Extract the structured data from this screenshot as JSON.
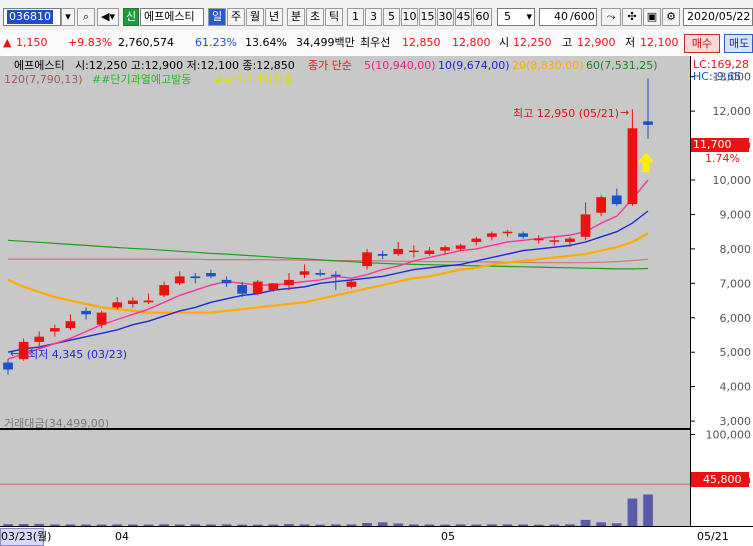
{
  "toolbar": {
    "code": "036810",
    "badge": "신",
    "name": "에프에스티",
    "periods": [
      "일",
      "주",
      "월",
      "년",
      "분",
      "초",
      "틱"
    ],
    "active_period": "일",
    "minutes": [
      "1",
      "3",
      "5",
      "10",
      "15",
      "30",
      "45",
      "60"
    ],
    "n_value": "5",
    "count": "40",
    "count_total": "/600",
    "date": "2020/05/22"
  },
  "quote": {
    "change": "1,150",
    "change_pct": "+9.83%",
    "volume": "2,760,574",
    "ratio1": "61.23%",
    "ratio2": "13.64%",
    "amount": "34,499백만",
    "best_label": "최우선",
    "ask": "12,850",
    "bid": "12,800",
    "open_label": "시",
    "open": "12,250",
    "high_label": "고",
    "high": "12,900",
    "low_label": "저",
    "low": "12,100",
    "buy_button": "매수",
    "sell_button": "매도"
  },
  "legend": {
    "title": "에프에스티",
    "ohlc": "시:12,250 고:12,900 저:12,100 종:12,850",
    "ma_header": "종가 단순",
    "ma5": "5(10,940,00)",
    "ma10": "10(9,674,00)",
    "ma20": "20(8,830,00)",
    "ma60": "60(7,531,25)",
    "ma120": "120(7,790,13)",
    "signal1": "##단기과열예고발동",
    "signal2": "##단기과열적출",
    "lc": "LC:169,28",
    "hc": "HC:-9,65",
    "volume_label": "거래대금(34,499,00)"
  },
  "annotations": {
    "high_text": "최고 12,950 (05/21)",
    "low_text": "최저 4,345 (03/23)",
    "current_price": "11,700",
    "current_pct": "1.74%",
    "volume_current": "45,800"
  },
  "dates": {
    "left": "03/23(월)",
    "apr": "04",
    "may": "05",
    "right": "05/21"
  },
  "chart_data": {
    "type": "candlestick",
    "price_axis": {
      "ticks": [
        3000,
        4000,
        5000,
        6000,
        7000,
        8000,
        9000,
        10000,
        11000,
        12000,
        13000
      ],
      "labels": [
        "3,000",
        "4,000",
        "5,000",
        "6,000",
        "7,000",
        "8,000",
        "9,000",
        "10,000",
        "11,000",
        "12,000",
        "13,000"
      ],
      "ylim": [
        2800,
        13600
      ]
    },
    "volume_axis": {
      "ticks": [
        50000,
        100000
      ],
      "labels": [
        "50,000",
        "100,000"
      ],
      "ylim": [
        0,
        105000
      ]
    },
    "candles": [
      {
        "o": 4700,
        "h": 4800,
        "l": 4345,
        "c": 4500
      },
      {
        "o": 4800,
        "h": 5400,
        "l": 4750,
        "c": 5300
      },
      {
        "o": 5300,
        "h": 5600,
        "l": 5100,
        "c": 5450
      },
      {
        "o": 5600,
        "h": 5800,
        "l": 5450,
        "c": 5700
      },
      {
        "o": 5700,
        "h": 6100,
        "l": 5650,
        "c": 5900
      },
      {
        "o": 6200,
        "h": 6300,
        "l": 5950,
        "c": 6100
      },
      {
        "o": 5800,
        "h": 6200,
        "l": 5700,
        "c": 6150
      },
      {
        "o": 6300,
        "h": 6600,
        "l": 6250,
        "c": 6450
      },
      {
        "o": 6400,
        "h": 6600,
        "l": 6300,
        "c": 6500
      },
      {
        "o": 6450,
        "h": 6700,
        "l": 6400,
        "c": 6500
      },
      {
        "o": 6650,
        "h": 7050,
        "l": 6600,
        "c": 6950
      },
      {
        "o": 7000,
        "h": 7350,
        "l": 6950,
        "c": 7200
      },
      {
        "o": 7200,
        "h": 7300,
        "l": 7000,
        "c": 7150
      },
      {
        "o": 7300,
        "h": 7400,
        "l": 7150,
        "c": 7200
      },
      {
        "o": 7100,
        "h": 7200,
        "l": 6900,
        "c": 7000
      },
      {
        "o": 6950,
        "h": 7050,
        "l": 6600,
        "c": 6700
      },
      {
        "o": 6700,
        "h": 7100,
        "l": 6650,
        "c": 7050
      },
      {
        "o": 6800,
        "h": 7000,
        "l": 6750,
        "c": 7000
      },
      {
        "o": 6950,
        "h": 7300,
        "l": 6800,
        "c": 7100
      },
      {
        "o": 7250,
        "h": 7550,
        "l": 7150,
        "c": 7350
      },
      {
        "o": 7300,
        "h": 7400,
        "l": 7200,
        "c": 7250
      },
      {
        "o": 7250,
        "h": 7350,
        "l": 6800,
        "c": 7200
      },
      {
        "o": 6900,
        "h": 7100,
        "l": 6850,
        "c": 7050
      },
      {
        "o": 7500,
        "h": 8000,
        "l": 7400,
        "c": 7900
      },
      {
        "o": 7850,
        "h": 7950,
        "l": 7700,
        "c": 7800
      },
      {
        "o": 7850,
        "h": 8200,
        "l": 7800,
        "c": 8000
      },
      {
        "o": 7950,
        "h": 8100,
        "l": 7750,
        "c": 7950
      },
      {
        "o": 7850,
        "h": 8050,
        "l": 7800,
        "c": 7950
      },
      {
        "o": 7950,
        "h": 8100,
        "l": 7850,
        "c": 8050
      },
      {
        "o": 8000,
        "h": 8150,
        "l": 7950,
        "c": 8100
      },
      {
        "o": 8200,
        "h": 8350,
        "l": 8100,
        "c": 8300
      },
      {
        "o": 8350,
        "h": 8500,
        "l": 8250,
        "c": 8450
      },
      {
        "o": 8500,
        "h": 8550,
        "l": 8350,
        "c": 8500
      },
      {
        "o": 8450,
        "h": 8500,
        "l": 8300,
        "c": 8350
      },
      {
        "o": 8250,
        "h": 8400,
        "l": 8150,
        "c": 8300
      },
      {
        "o": 8250,
        "h": 8350,
        "l": 8100,
        "c": 8250
      },
      {
        "o": 8200,
        "h": 8350,
        "l": 8050,
        "c": 8300
      },
      {
        "o": 8350,
        "h": 9350,
        "l": 8250,
        "c": 9000
      },
      {
        "o": 9050,
        "h": 9550,
        "l": 8950,
        "c": 9500
      },
      {
        "o": 9550,
        "h": 9750,
        "l": 9250,
        "c": 9300
      },
      {
        "o": 9300,
        "h": 12050,
        "l": 9250,
        "c": 11500
      },
      {
        "o": 11700,
        "h": 12950,
        "l": 11200,
        "c": 11600
      }
    ],
    "volumes": [
      2000,
      2100,
      2300,
      1800,
      1700,
      1600,
      1600,
      1700,
      1600,
      1500,
      1900,
      1600,
      1700,
      1600,
      1800,
      1500,
      1400,
      1600,
      2100,
      1700,
      1500,
      1700,
      1800,
      3300,
      4000,
      2700,
      1800,
      1600,
      1500,
      1800,
      1500,
      1800,
      1700,
      1600,
      1400,
      1600,
      1900,
      6700,
      4100,
      3000,
      30000,
      34499
    ],
    "ma5": [
      4800,
      4950,
      5100,
      5250,
      5400,
      5600,
      5800,
      5950,
      6100,
      6250,
      6450,
      6650,
      6800,
      6950,
      7050,
      7000,
      6950,
      6950,
      7000,
      7050,
      7100,
      7200,
      7150,
      7250,
      7400,
      7500,
      7650,
      7750,
      7850,
      7950,
      8000,
      8100,
      8200,
      8250,
      8300,
      8350,
      8400,
      8500,
      8750,
      8950,
      9450,
      10000
    ],
    "ma10": [
      5000,
      5100,
      5150,
      5250,
      5350,
      5450,
      5550,
      5650,
      5800,
      5900,
      6050,
      6200,
      6300,
      6450,
      6550,
      6650,
      6700,
      6800,
      6850,
      6900,
      7000,
      7050,
      7100,
      7150,
      7200,
      7300,
      7400,
      7450,
      7500,
      7550,
      7650,
      7750,
      7850,
      7950,
      8000,
      8050,
      8100,
      8200,
      8350,
      8500,
      8750,
      9100
    ],
    "ma20": [
      7100,
      6900,
      6750,
      6600,
      6500,
      6400,
      6300,
      6250,
      6200,
      6150,
      6150,
      6150,
      6150,
      6150,
      6200,
      6250,
      6300,
      6350,
      6400,
      6450,
      6550,
      6650,
      6750,
      6850,
      6950,
      7050,
      7150,
      7200,
      7300,
      7400,
      7450,
      7550,
      7600,
      7650,
      7700,
      7750,
      7800,
      7850,
      7950,
      8050,
      8200,
      8450
    ],
    "ma60": [
      8250,
      8220,
      8190,
      8160,
      8130,
      8100,
      8070,
      8040,
      8010,
      7990,
      7960,
      7930,
      7900,
      7870,
      7850,
      7820,
      7790,
      7760,
      7730,
      7710,
      7680,
      7650,
      7630,
      7600,
      7580,
      7560,
      7550,
      7540,
      7530,
      7520,
      7510,
      7500,
      7490,
      7480,
      7470,
      7460,
      7450,
      7440,
      7430,
      7420,
      7420,
      7430
    ],
    "ma120": [
      7700,
      7700,
      7700,
      7700,
      7700,
      7700,
      7700,
      7700,
      7700,
      7700,
      7700,
      7700,
      7700,
      7690,
      7690,
      7690,
      7690,
      7680,
      7680,
      7670,
      7670,
      7660,
      7660,
      7650,
      7650,
      7640,
      7640,
      7630,
      7630,
      7630,
      7620,
      7620,
      7610,
      7610,
      7600,
      7600,
      7600,
      7600,
      7610,
      7630,
      7660,
      7700
    ]
  },
  "colors": {
    "up": "#ee1111",
    "down": "#1a50c8",
    "ma5": "#ff3399",
    "ma10": "#1a2ad8",
    "ma20": "#ffaa00",
    "ma60": "#20a020",
    "ma120": "#c87a7a"
  }
}
